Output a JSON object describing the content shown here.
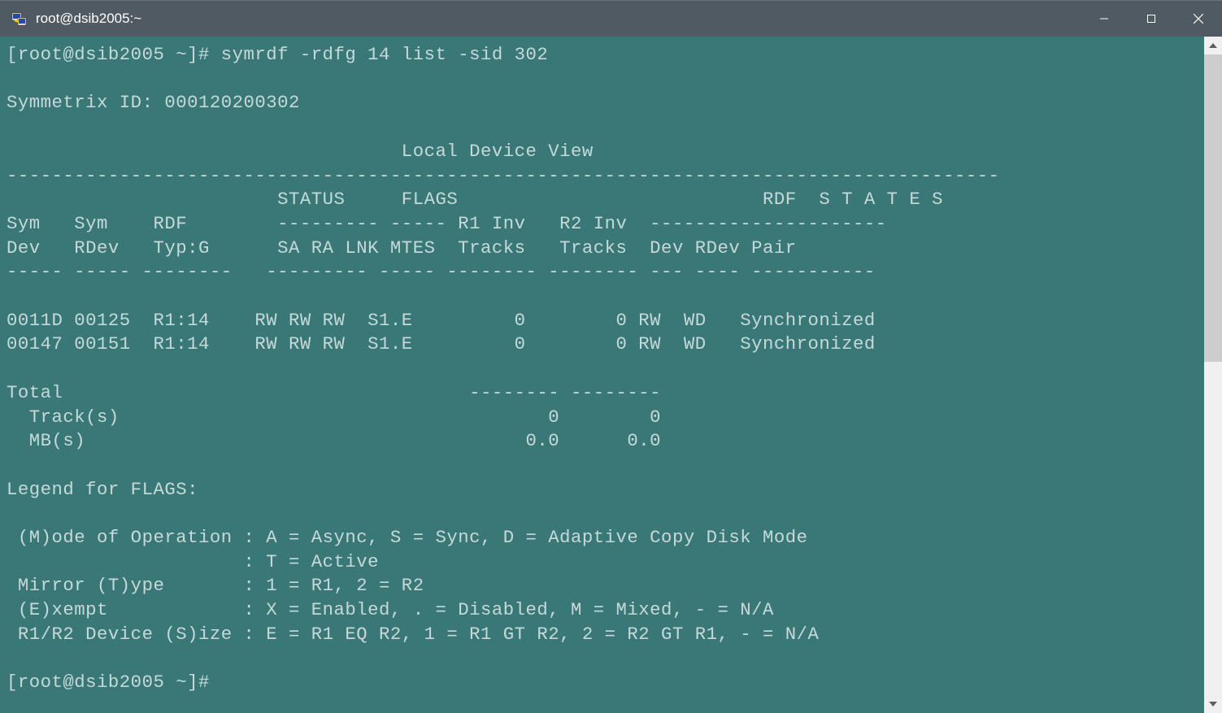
{
  "window": {
    "title": "root@dsib2005:~"
  },
  "terminal": {
    "prompt1": "[root@dsib2005 ~]# ",
    "command": "symrdf -rdfg 14 list -sid 302",
    "symmetrix_line": "Symmetrix ID: 000120200302",
    "view_title": "                                   Local Device View",
    "sep_full": "----------------------------------------------------------------------------------------",
    "header1": "                        STATUS     FLAGS                           RDF  S T A T E S",
    "header2": "Sym   Sym    RDF        --------- ----- R1 Inv   R2 Inv  ---------------------",
    "header3": "Dev   RDev   Typ:G      SA RA LNK MTES  Tracks   Tracks  Dev RDev Pair",
    "sep_cols": "----- ----- --------   --------- ----- -------- -------- --- ---- -----------",
    "rows": [
      "0011D 00125  R1:14    RW RW RW  S1.E         0        0 RW  WD   Synchronized",
      "00147 00151  R1:14    RW RW RW  S1.E         0        0 RW  WD   Synchronized"
    ],
    "total_line": "Total                                    -------- --------",
    "tracks_line": "  Track(s)                                      0        0",
    "mbs_line": "  MB(s)                                       0.0      0.0",
    "legend_title": "Legend for FLAGS:",
    "legend_lines": [
      " (M)ode of Operation : A = Async, S = Sync, D = Adaptive Copy Disk Mode",
      "                     : T = Active",
      " Mirror (T)ype       : 1 = R1, 2 = R2",
      " (E)xempt            : X = Enabled, . = Disabled, M = Mixed, - = N/A",
      " R1/R2 Device (S)ize : E = R1 EQ R2, 1 = R1 GT R2, 2 = R2 GT R1, - = N/A"
    ],
    "prompt2": "[root@dsib2005 ~]#"
  },
  "chart_data": {
    "type": "table",
    "title": "Local Device View",
    "symmetrix_id": "000120200302",
    "columns": [
      "Sym Dev",
      "Sym RDev",
      "RDF Typ:G",
      "SA",
      "RA",
      "LNK",
      "MTES",
      "R1 Inv Tracks",
      "R2 Inv Tracks",
      "Dev",
      "RDev",
      "Pair"
    ],
    "rows": [
      {
        "sym_dev": "0011D",
        "sym_rdev": "00125",
        "rdf_typ_g": "R1:14",
        "sa": "RW",
        "ra": "RW",
        "lnk": "RW",
        "mtes": "S1.E",
        "r1_inv_tracks": 0,
        "r2_inv_tracks": 0,
        "dev": "RW",
        "rdev": "WD",
        "pair": "Synchronized"
      },
      {
        "sym_dev": "00147",
        "sym_rdev": "00151",
        "rdf_typ_g": "R1:14",
        "sa": "RW",
        "ra": "RW",
        "lnk": "RW",
        "mtes": "S1.E",
        "r1_inv_tracks": 0,
        "r2_inv_tracks": 0,
        "dev": "RW",
        "rdev": "WD",
        "pair": "Synchronized"
      }
    ],
    "totals": {
      "tracks_r1": 0,
      "tracks_r2": 0,
      "mb_r1": 0.0,
      "mb_r2": 0.0
    }
  }
}
